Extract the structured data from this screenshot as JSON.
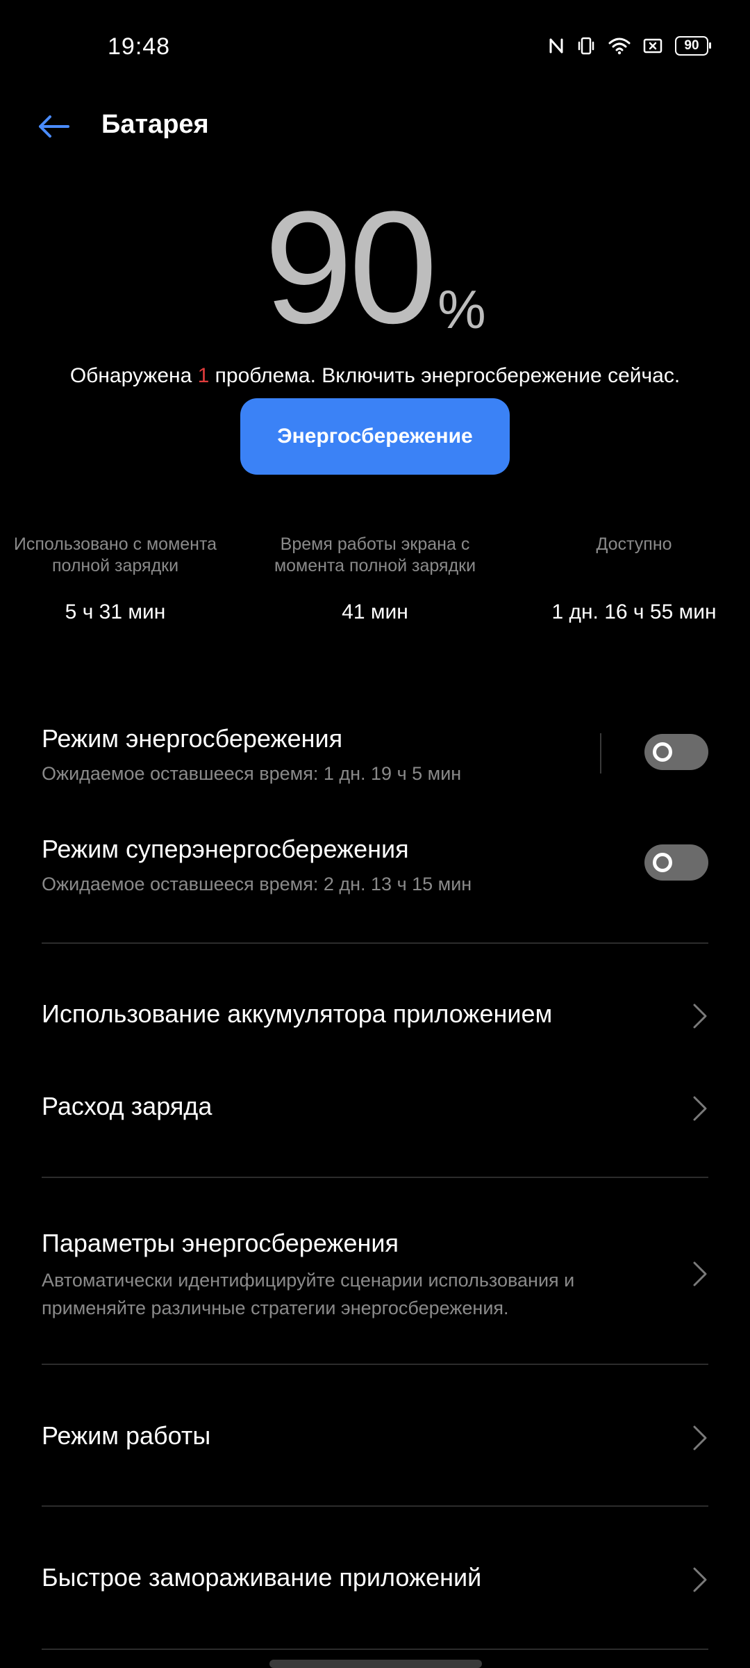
{
  "status_bar": {
    "time": "19:48",
    "icons": [
      "nfc-icon",
      "vibrate-icon",
      "wifi-icon",
      "screenshot-icon"
    ],
    "battery_level": "90"
  },
  "header": {
    "title": "Батарея",
    "back_icon": "arrow-left-icon"
  },
  "battery": {
    "level": "90",
    "unit": "%",
    "issue_prefix": "Обнаружена ",
    "issue_count": "1",
    "issue_suffix": " проблема. Включить энергосбережение сейчас.",
    "saver_button_label": "Энергосбережение"
  },
  "stats": [
    {
      "label": "Использовано с момента полной зарядки",
      "value": "5 ч 31 мин"
    },
    {
      "label": "Время работы экрана с момента полной зарядки",
      "value": "41 мин"
    },
    {
      "label": "Доступно",
      "value": "1 дн. 16 ч 55 мин"
    }
  ],
  "modes": [
    {
      "title": "Режим энергосбережения",
      "subtitle": "Ожидаемое оставшееся время:  1 дн. 19 ч 5 мин",
      "enabled": false
    },
    {
      "title": "Режим суперэнергосбережения",
      "subtitle": "Ожидаемое оставшееся время:  2 дн. 13 ч 15 мин",
      "enabled": false
    }
  ],
  "menu": [
    {
      "title": "Использование аккумулятора приложением"
    },
    {
      "title": "Расход заряда"
    },
    {
      "title": "Параметры энергосбережения",
      "subtitle": "Автоматически идентифицируйте сценарии использования и применяйте различные стратегии энергосбережения."
    },
    {
      "title": "Режим работы"
    },
    {
      "title": "Быстрое замораживание приложений"
    }
  ],
  "colors": {
    "background": "#000000",
    "accent": "#3b82f6",
    "issue": "#e03c3c",
    "toggle_off": "#6b6b6b",
    "secondary_text": "#8a8a8a"
  }
}
